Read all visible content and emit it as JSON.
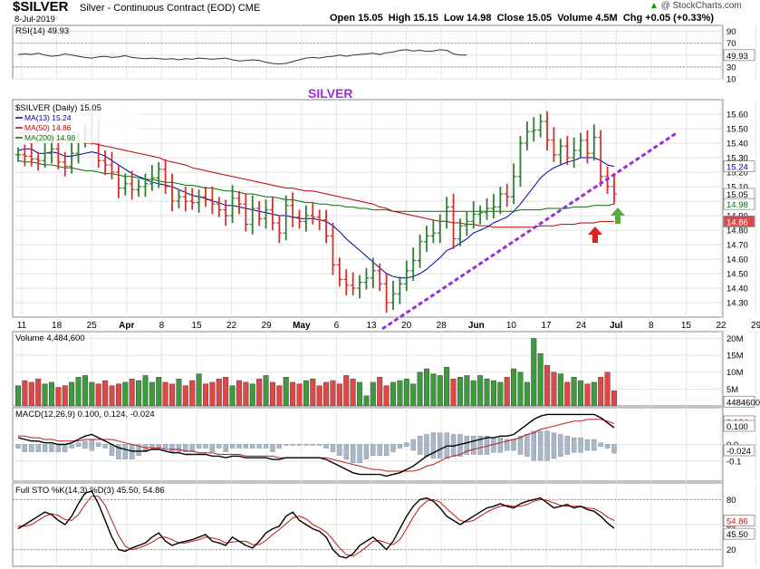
{
  "header": {
    "symbol": "$SILVER",
    "name": "Silver - Continuous Contract (EOD)",
    "exchange": "CME",
    "date": "8-Jul-2019",
    "quote_line": "Open 15.05  High 15.15  Low 14.98  Close 15.05  Volume 4.5M  Chg +0.05 (+0.33%)",
    "brand": "@ StockCharts.com",
    "trend_icon": "up-triangle-icon",
    "trend_color": "#00a000"
  },
  "colors": {
    "up": "#2e7d32",
    "down": "#d32f2f",
    "ma13": "#0000a0",
    "ma50": "#c00000",
    "ma200": "#007000",
    "trendline": "#9b30d9",
    "volume_up": "#3d9a3d",
    "volume_down": "#e04848",
    "title_text": "#9b30d9"
  },
  "chart_data": [
    {
      "type": "line",
      "title": "RSI(14) 49.93",
      "ylim": [
        10,
        100
      ],
      "yticks": [
        "90",
        "70",
        "50",
        "30",
        "10"
      ],
      "ref_lines": [
        70,
        30
      ],
      "last_label": "49.93",
      "series": [
        {
          "name": "RSI(14)",
          "values": [
            51,
            52,
            51,
            53,
            50,
            48,
            49,
            52,
            50,
            48,
            46,
            45,
            47,
            48,
            46,
            47,
            49,
            46,
            45,
            44,
            45,
            44,
            43,
            44,
            42,
            44,
            43,
            45,
            44,
            43,
            44,
            45,
            42,
            40,
            41,
            42,
            41,
            38,
            36,
            35,
            36,
            39,
            42,
            45,
            46,
            45,
            47,
            48,
            50,
            48,
            50,
            51,
            52,
            53,
            51,
            54,
            55,
            58,
            59,
            57,
            58,
            56,
            57,
            59,
            58,
            52,
            50,
            49.93
          ]
        }
      ]
    },
    {
      "type": "candlestick",
      "title": "$SILVER (Daily) 15.05",
      "annotation": "SILVER",
      "ylim": [
        14.2,
        15.7
      ],
      "yticks": [
        "15.60",
        "15.50",
        "15.40",
        "15.30",
        "15.20",
        "15.10",
        "15.00",
        "14.90",
        "14.80",
        "14.70",
        "14.60",
        "14.50",
        "14.40",
        "14.30"
      ],
      "x_tick_labels": [
        "11",
        "18",
        "25",
        "Apr",
        "8",
        "15",
        "22",
        "29",
        "May",
        "6",
        "13",
        "20",
        "28",
        "Jun",
        "10",
        "17",
        "24",
        "Jul",
        "8",
        "15",
        "22",
        "29"
      ],
      "legend": [
        {
          "name": "MA(13) 15.24",
          "color": "#0000a0"
        },
        {
          "name": "MA(50) 14.86",
          "color": "#c00000"
        },
        {
          "name": "MA(200) 14.98",
          "color": "#007000"
        }
      ],
      "last_price_label": "15.05",
      "ma_labels": [
        "15.24",
        "14.98",
        "14.86"
      ],
      "close": [
        15.32,
        15.31,
        15.29,
        15.28,
        15.33,
        15.36,
        15.27,
        15.24,
        15.33,
        15.42,
        15.46,
        15.52,
        15.28,
        15.25,
        15.2,
        15.09,
        15.12,
        15.08,
        15.1,
        15.12,
        15.16,
        15.22,
        15.1,
        15.0,
        15.03,
        15.0,
        14.99,
        15.03,
        15.01,
        14.98,
        14.94,
        14.9,
        15.02,
        14.98,
        14.84,
        14.95,
        14.88,
        14.94,
        14.85,
        14.78,
        14.97,
        14.89,
        14.86,
        14.9,
        14.89,
        14.87,
        14.76,
        14.56,
        14.46,
        14.42,
        14.4,
        14.44,
        14.47,
        14.52,
        14.43,
        14.3,
        14.36,
        14.43,
        14.52,
        14.59,
        14.72,
        14.76,
        14.78,
        14.86,
        14.96,
        14.74,
        14.83,
        14.86,
        14.91,
        14.92,
        14.95,
        14.96,
        15.05,
        15.03,
        15.17,
        15.4,
        15.48,
        15.49,
        15.55,
        15.42,
        15.32,
        15.38,
        15.3,
        15.35,
        15.42,
        15.33,
        15.44,
        15.17,
        15.1,
        15.05
      ],
      "ma13": [
        15.35,
        15.36,
        15.36,
        15.33,
        15.33,
        15.34,
        15.33,
        15.31,
        15.31,
        15.32,
        15.33,
        15.34,
        15.33,
        15.31,
        15.28,
        15.25,
        15.22,
        15.19,
        15.17,
        15.15,
        15.13,
        15.12,
        15.11,
        15.1,
        15.08,
        15.06,
        15.04,
        15.03,
        15.02,
        15.0,
        14.99,
        14.97,
        14.97,
        14.96,
        14.95,
        14.94,
        14.93,
        14.92,
        14.91,
        14.9,
        14.9,
        14.89,
        14.88,
        14.88,
        14.88,
        14.87,
        14.86,
        14.83,
        14.79,
        14.74,
        14.7,
        14.66,
        14.62,
        14.58,
        14.54,
        14.5,
        14.48,
        14.47,
        14.47,
        14.48,
        14.5,
        14.53,
        14.57,
        14.61,
        14.66,
        14.68,
        14.71,
        14.74,
        14.78,
        14.8,
        14.82,
        14.85,
        14.87,
        14.89,
        14.93,
        14.98,
        15.04,
        15.1,
        15.16,
        15.2,
        15.23,
        15.25,
        15.27,
        15.28,
        15.3,
        15.3,
        15.3,
        15.28,
        15.25,
        15.24
      ],
      "ma50": [
        15.47,
        15.47,
        15.47,
        15.46,
        15.45,
        15.44,
        15.43,
        15.42,
        15.42,
        15.41,
        15.4,
        15.4,
        15.39,
        15.38,
        15.37,
        15.36,
        15.35,
        15.34,
        15.33,
        15.32,
        15.31,
        15.3,
        15.28,
        15.27,
        15.26,
        15.25,
        15.23,
        15.22,
        15.21,
        15.2,
        15.19,
        15.18,
        15.17,
        15.16,
        15.15,
        15.14,
        15.13,
        15.12,
        15.11,
        15.1,
        15.09,
        15.09,
        15.08,
        15.07,
        15.07,
        15.06,
        15.05,
        15.04,
        15.03,
        15.02,
        15.01,
        15.0,
        14.99,
        14.98,
        14.96,
        14.95,
        14.93,
        14.92,
        14.91,
        14.9,
        14.89,
        14.88,
        14.87,
        14.86,
        14.86,
        14.85,
        14.85,
        14.84,
        14.84,
        14.83,
        14.83,
        14.82,
        14.82,
        14.82,
        14.82,
        14.82,
        14.82,
        14.82,
        14.83,
        14.83,
        14.83,
        14.84,
        14.84,
        14.84,
        14.85,
        14.85,
        14.85,
        14.86,
        14.86,
        14.86
      ],
      "ma200": [
        15.28,
        15.27,
        15.27,
        15.26,
        15.25,
        15.25,
        15.24,
        15.23,
        15.23,
        15.22,
        15.21,
        15.21,
        15.2,
        15.19,
        15.19,
        15.18,
        15.17,
        15.17,
        15.16,
        15.15,
        15.15,
        15.14,
        15.13,
        15.13,
        15.12,
        15.11,
        15.11,
        15.1,
        15.09,
        15.09,
        15.08,
        15.07,
        15.07,
        15.06,
        15.05,
        15.05,
        15.04,
        15.03,
        15.03,
        15.02,
        15.01,
        15.01,
        15.0,
        14.99,
        14.99,
        14.98,
        14.98,
        14.97,
        14.97,
        14.96,
        14.96,
        14.95,
        14.95,
        14.94,
        14.94,
        14.94,
        14.93,
        14.93,
        14.93,
        14.93,
        14.93,
        14.93,
        14.93,
        14.93,
        14.93,
        14.93,
        14.93,
        14.93,
        14.93,
        14.93,
        14.93,
        14.93,
        14.93,
        14.93,
        14.93,
        14.94,
        14.94,
        14.94,
        14.94,
        14.95,
        14.95,
        14.95,
        14.95,
        14.96,
        14.96,
        14.96,
        14.97,
        14.97,
        14.97,
        14.98
      ]
    },
    {
      "type": "bar",
      "title": "Volume 4,484,600",
      "yticks": [
        "20M",
        "15M",
        "10M",
        "5M"
      ],
      "last_label": "4484600",
      "values": [
        6.0,
        7.5,
        7.0,
        8.0,
        6.5,
        7.0,
        5.5,
        6.0,
        7.0,
        8.5,
        9.0,
        7.0,
        6.5,
        7.5,
        6.0,
        6.5,
        7.0,
        8.0,
        7.5,
        9.0,
        7.0,
        8.5,
        7.0,
        6.5,
        8.0,
        6.0,
        7.5,
        9.5,
        6.5,
        7.0,
        8.0,
        8.5,
        6.0,
        7.5,
        7.0,
        6.5,
        8.0,
        9.0,
        7.0,
        6.0,
        8.5,
        7.0,
        6.5,
        7.5,
        8.0,
        6.0,
        7.0,
        7.5,
        6.5,
        9.0,
        8.0,
        7.0,
        3.0,
        7.0,
        8.5,
        6.0,
        7.0,
        7.5,
        8.0,
        6.5,
        10.0,
        11.0,
        9.5,
        9.0,
        11.5,
        8.0,
        8.5,
        9.0,
        7.5,
        9.0,
        8.0,
        7.5,
        7.0,
        8.5,
        11.0,
        10.0,
        7.0,
        20.0,
        15.5,
        12.0,
        10.0,
        9.5,
        7.0,
        8.5,
        7.5,
        6.5,
        7.0,
        8.5,
        10.0,
        4.48
      ]
    },
    {
      "type": "line",
      "title": "MACD(12,26,9) 0.100, 0.124, -0.024",
      "yticks": [
        "0.0",
        "-0.1"
      ],
      "right_labels": [
        "0.124",
        "0.100",
        "-0.024"
      ],
      "series": [
        {
          "name": "MACD",
          "values": [
            0.04,
            0.03,
            0.02,
            0.02,
            0.01,
            0.01,
            0.0,
            0.0,
            0.01,
            0.03,
            0.05,
            0.06,
            0.04,
            0.02,
            0.0,
            -0.02,
            -0.03,
            -0.04,
            -0.04,
            -0.04,
            -0.03,
            -0.03,
            -0.04,
            -0.05,
            -0.05,
            -0.06,
            -0.06,
            -0.06,
            -0.06,
            -0.07,
            -0.07,
            -0.08,
            -0.07,
            -0.07,
            -0.08,
            -0.08,
            -0.08,
            -0.08,
            -0.09,
            -0.09,
            -0.08,
            -0.08,
            -0.08,
            -0.08,
            -0.08,
            -0.08,
            -0.09,
            -0.11,
            -0.13,
            -0.15,
            -0.17,
            -0.18,
            -0.18,
            -0.18,
            -0.18,
            -0.19,
            -0.18,
            -0.17,
            -0.15,
            -0.13,
            -0.1,
            -0.07,
            -0.05,
            -0.03,
            -0.01,
            -0.01,
            0.0,
            0.01,
            0.02,
            0.03,
            0.04,
            0.04,
            0.05,
            0.05,
            0.06,
            0.09,
            0.12,
            0.15,
            0.17,
            0.18,
            0.18,
            0.18,
            0.18,
            0.18,
            0.18,
            0.18,
            0.18,
            0.16,
            0.13,
            0.1
          ]
        },
        {
          "name": "Signal",
          "values": [
            0.05,
            0.05,
            0.04,
            0.04,
            0.03,
            0.03,
            0.02,
            0.02,
            0.02,
            0.02,
            0.03,
            0.03,
            0.03,
            0.03,
            0.03,
            0.02,
            0.01,
            0.0,
            -0.01,
            -0.02,
            -0.02,
            -0.02,
            -0.03,
            -0.03,
            -0.03,
            -0.04,
            -0.04,
            -0.05,
            -0.05,
            -0.05,
            -0.06,
            -0.06,
            -0.06,
            -0.06,
            -0.07,
            -0.07,
            -0.07,
            -0.07,
            -0.07,
            -0.08,
            -0.08,
            -0.08,
            -0.08,
            -0.08,
            -0.08,
            -0.08,
            -0.08,
            -0.09,
            -0.1,
            -0.11,
            -0.12,
            -0.13,
            -0.14,
            -0.15,
            -0.15,
            -0.16,
            -0.16,
            -0.16,
            -0.16,
            -0.16,
            -0.15,
            -0.13,
            -0.12,
            -0.1,
            -0.08,
            -0.07,
            -0.06,
            -0.04,
            -0.03,
            -0.02,
            -0.01,
            0.0,
            0.01,
            0.02,
            0.03,
            0.04,
            0.06,
            0.07,
            0.09,
            0.1,
            0.11,
            0.12,
            0.13,
            0.14,
            0.14,
            0.15,
            0.15,
            0.15,
            0.14,
            0.124
          ]
        }
      ]
    },
    {
      "type": "line",
      "title": "Full STO %K(14,3) %D(3) 45.50, 54.86",
      "ylim": [
        0,
        100
      ],
      "yticks": [
        "80",
        "50",
        "20"
      ],
      "right_labels": [
        "54.86",
        "45.50"
      ],
      "series": [
        {
          "name": "%K",
          "values": [
            45,
            50,
            55,
            60,
            65,
            62,
            55,
            50,
            60,
            75,
            88,
            90,
            75,
            55,
            35,
            20,
            18,
            22,
            25,
            28,
            35,
            40,
            30,
            25,
            28,
            30,
            32,
            35,
            38,
            30,
            28,
            25,
            35,
            30,
            25,
            22,
            30,
            40,
            45,
            48,
            60,
            65,
            55,
            50,
            45,
            42,
            35,
            20,
            12,
            10,
            15,
            25,
            30,
            35,
            28,
            20,
            30,
            45,
            60,
            72,
            80,
            82,
            78,
            70,
            60,
            55,
            50,
            55,
            60,
            65,
            70,
            72,
            75,
            72,
            70,
            75,
            78,
            80,
            82,
            76,
            70,
            72,
            74,
            70,
            72,
            68,
            66,
            60,
            52,
            45.5
          ]
        },
        {
          "name": "%D",
          "values": [
            48,
            48,
            50,
            55,
            60,
            63,
            61,
            56,
            55,
            62,
            74,
            84,
            84,
            73,
            55,
            37,
            24,
            20,
            22,
            25,
            29,
            34,
            35,
            32,
            28,
            28,
            30,
            32,
            35,
            34,
            32,
            28,
            29,
            30,
            30,
            26,
            26,
            31,
            38,
            44,
            51,
            58,
            60,
            57,
            50,
            46,
            41,
            32,
            22,
            14,
            12,
            17,
            23,
            30,
            31,
            28,
            26,
            32,
            45,
            59,
            71,
            78,
            80,
            77,
            69,
            62,
            55,
            53,
            55,
            60,
            65,
            69,
            72,
            73,
            72,
            72,
            74,
            78,
            80,
            79,
            76,
            73,
            72,
            72,
            72,
            70,
            69,
            65,
            59,
            54.86
          ]
        }
      ]
    }
  ]
}
